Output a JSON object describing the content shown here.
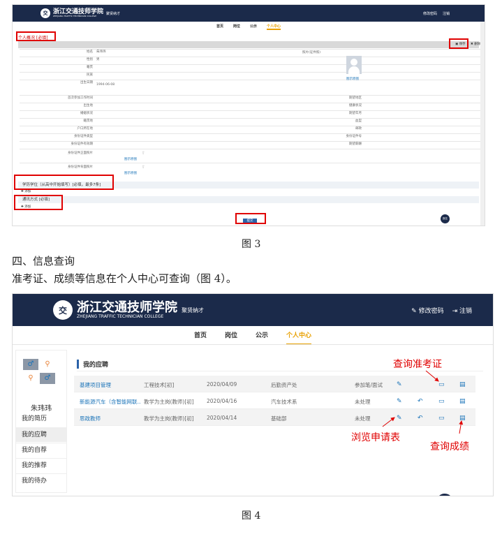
{
  "fig3": {
    "school_name": "浙江交通技师学院",
    "school_name_en": "ZHEJIANG TRAFFIC TECHNICIAN COLLEGE",
    "site_name": "聚贤纳才",
    "header_actions": [
      "修改密码",
      "注销"
    ],
    "nav": [
      "首页",
      "岗位",
      "公示",
      "个人中心"
    ],
    "section_personal": "个人概况 [必填]",
    "btn_save": "保存",
    "btn_delete": "删除",
    "left_rows": [
      {
        "label": "姓名",
        "value": "朱玮玮"
      },
      {
        "label": "性别",
        "value": "男"
      },
      {
        "label": "籍贯",
        "value": ""
      },
      {
        "label": "民族",
        "value": ""
      },
      {
        "label": "出生日期",
        "value": "1994-06-08"
      }
    ],
    "photo_label": "照片(证件照)",
    "photo_link": "图示原图",
    "double_rows": [
      {
        "l1": "首次参加工作时间",
        "l2": "期望地区"
      },
      {
        "l1": "出生地",
        "l2": "健康状况"
      },
      {
        "l1": "婚姻状况",
        "l2": "期望年月"
      },
      {
        "l1": "籍贯地",
        "l2": "血型"
      },
      {
        "l1": "户口所在地",
        "l2": "邮政"
      },
      {
        "l1": "身份证件类型",
        "l2": "身份证件号"
      },
      {
        "l1": "身份证件有效期",
        "l2": "期望薪酬"
      }
    ],
    "id_front": "身份证件正面照片",
    "id_back": "身份证件背面照片",
    "img_link": "图示原图",
    "section_edu": "学历学位（从高中开始填写）[必填，最多7条]",
    "add_btn": "添加",
    "section_contact": "通讯方式 [必填]",
    "submit": "提交",
    "badge": "报名"
  },
  "caption3": "图 3",
  "heading": "四、信息查询",
  "paragraph": "准考证、成绩等信息在个人中心可查询（图 4）。",
  "fig4": {
    "school_name": "浙江交通技师学院",
    "school_name_en": "ZHEJIANG TRAFFIC TECHNICIAN COLLEGE",
    "site_name": "聚贤纳才",
    "header_actions": [
      "修改密码",
      "注销"
    ],
    "nav": [
      "首页",
      "岗位",
      "公示",
      "个人中心"
    ],
    "user_name": "朱玮玮",
    "side_menu": [
      "我的简历",
      "我的应聘",
      "我的自荐",
      "我的推荐",
      "我的待办"
    ],
    "section_title": "我的应聘",
    "rows": [
      {
        "post": "基建项目管理",
        "type": "工程技术[初]",
        "date": "2020/04/09",
        "dept": "后勤资产处",
        "status": "参加笔/面试"
      },
      {
        "post": "新能源汽车（含智能网联…",
        "type": "教学为主岗(教师)[初]",
        "date": "2020/04/16",
        "dept": "汽车技术系",
        "status": "未处理"
      },
      {
        "post": "思政教师",
        "type": "教学为主岗(教师)[初]",
        "date": "2020/04/14",
        "dept": "基础部",
        "status": "未处理"
      }
    ],
    "annot_admission": "查询准考证",
    "annot_application": "浏览申请表",
    "annot_score": "查询成绩"
  },
  "caption4": "图 4",
  "colors": {
    "header": "#1b2a4a",
    "accent": "#e8a000",
    "red": "#e00000",
    "link": "#1a73b8"
  }
}
